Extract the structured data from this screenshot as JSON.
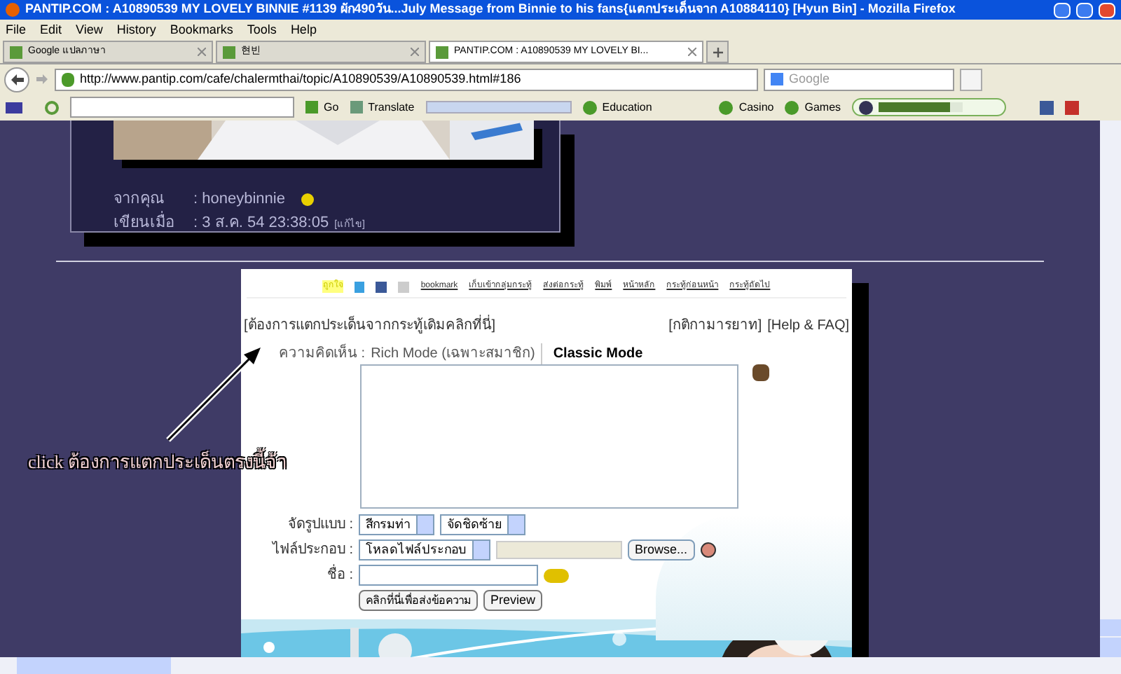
{
  "window": {
    "title": "PANTIP.COM : A10890539 MY LOVELY BINNIE #1139 ผัก490วัน...July Message from Binnie to his fans{แตกประเด็นจาก A10884110} [Hyun Bin] - Mozilla Firefox"
  },
  "menu": [
    "File",
    "Edit",
    "View",
    "History",
    "Bookmarks",
    "Tools",
    "Help"
  ],
  "tabs": [
    {
      "label": "Google แปลภาษา",
      "selected": false
    },
    {
      "label": "현빈",
      "selected": false
    },
    {
      "label": "PANTIP.COM : A10890539 MY LOVELY BI...",
      "selected": true
    }
  ],
  "nav": {
    "url": "http://www.pantip.com/cafe/chalermthai/topic/A10890539/A10890539.html#186",
    "search_placeholder": "Google"
  },
  "toolbar": {
    "go": "Go",
    "translate": "Translate",
    "items": [
      "Education",
      "Casino",
      "Games"
    ],
    "volume": {
      "level": 0.85
    }
  },
  "post": {
    "from_label": "จากคุณ",
    "from_value": ": honeybinnie",
    "written_label": "เขียนเมื่อ",
    "written_value": ": 3 ส.ค. 54 23:38:05",
    "edit": "[แก้ไข]"
  },
  "form": {
    "share": "ถูกใจ",
    "links": [
      "bookmark",
      "เก็บเข้ากลุ่มกระทู้",
      "ส่งต่อกระทู้",
      "พิมพ์",
      "หน้าหลัก",
      "กระทู้ก่อนหน้า",
      "กระทู้ถัดไป"
    ],
    "split_link": "[ต้องการแตกประเด็นจากกระทู้เดิมคลิกที่นี่]",
    "rules": "[กติกามารยาท]",
    "help": "[Help & FAQ]",
    "comment_label": "ความคิดเห็น :",
    "rich_mode": "Rich Mode (เฉพาะสมาชิก)",
    "classic_mode": "Classic Mode",
    "format_label": "จัดรูปแบบ :",
    "color_select": "สีกรมท่า",
    "align_select": "จัดชิดซ้าย",
    "file_label": "ไฟล์ประกอบ :",
    "file_select": "โหลดไฟล์ประกอบ",
    "browse": "Browse...",
    "name_label": "ชื่อ :",
    "submit": "คลิกที่นี่เพื่อส่งข้อความ",
    "preview": "Preview"
  },
  "annotation": "click ต้องการแตกประเด็นตรงนี้จ้า"
}
